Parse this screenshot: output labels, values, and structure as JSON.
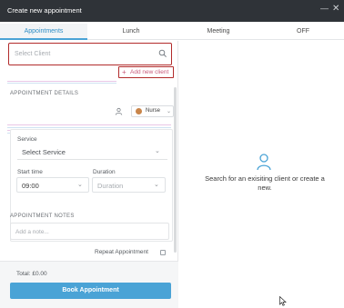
{
  "window": {
    "title": "Create new appointment"
  },
  "tabs": [
    {
      "label": "Appointments",
      "active": true
    },
    {
      "label": "Lunch",
      "active": false
    },
    {
      "label": "Meeting",
      "active": false
    },
    {
      "label": "OFF",
      "active": false
    }
  ],
  "client": {
    "search_placeholder": "Select Client",
    "add_new_label": "Add new client"
  },
  "details": {
    "section_title": "APPOINTMENT DETAILS",
    "staff": "Nurse",
    "service_label": "Service",
    "service_placeholder": "Select Service",
    "start_time_label": "Start time",
    "start_time_value": "09:00",
    "duration_label": "Duration",
    "duration_placeholder": "Duration"
  },
  "notes": {
    "section_title": "APPOINTMENT NOTES",
    "placeholder": "Add a note..."
  },
  "repeat_label": "Repeat Appointment",
  "footer": {
    "total": "Total: £0.00",
    "book_label": "Book Appointment"
  },
  "empty_state": {
    "message": "Search for an exisiting client or create a new."
  },
  "colors": {
    "titlebar": "#2f3338",
    "accent": "#4aa3d6",
    "highlight_border": "#b22b2b",
    "link": "#c85a7a"
  }
}
